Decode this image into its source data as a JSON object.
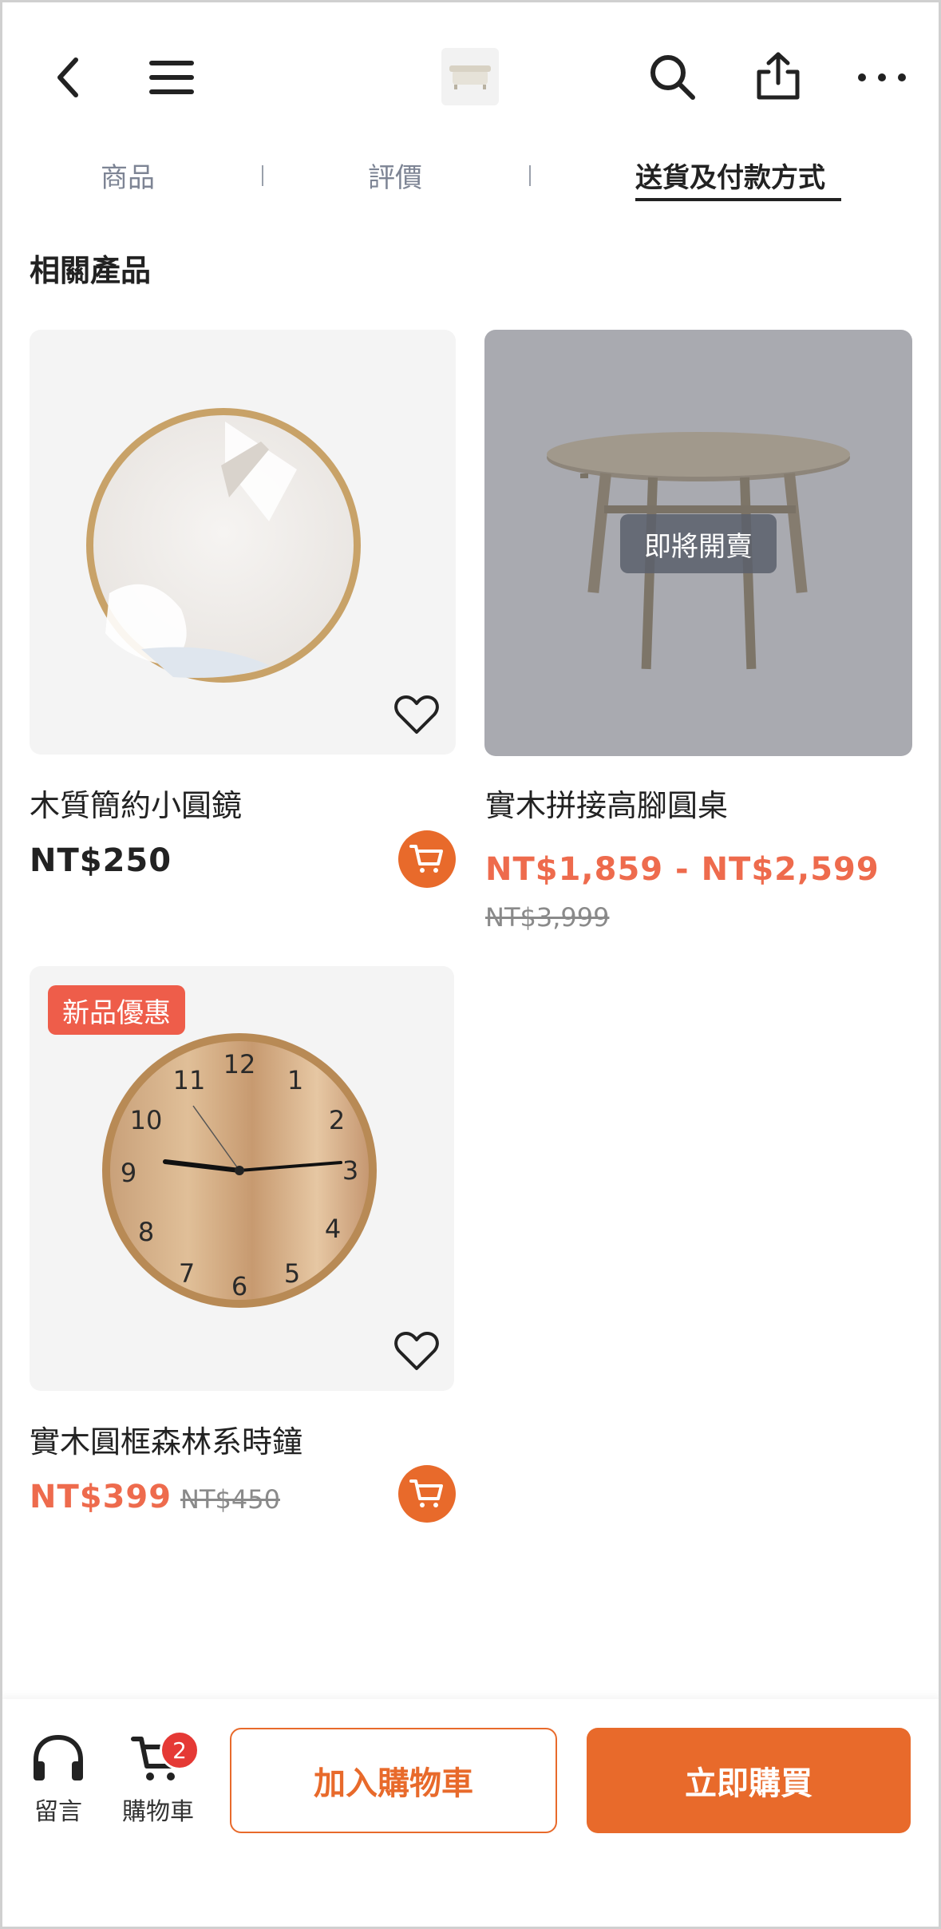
{
  "header": {
    "back_icon": "chevron-left-icon",
    "menu_icon": "hamburger-menu-icon",
    "search_icon": "search-icon",
    "share_icon": "share-icon",
    "more_icon": "more-horizontal-icon"
  },
  "tabs": [
    {
      "label": "商品",
      "active": false
    },
    {
      "label": "評價",
      "active": false
    },
    {
      "label": "送貨及付款方式",
      "active": true
    }
  ],
  "related": {
    "title": "相關產品",
    "products": [
      {
        "name": "木質簡約小圓鏡",
        "price": "NT$250",
        "old_price": "",
        "badge": ""
      },
      {
        "name": "實木拼接高腳圓桌",
        "price": "NT$1,859 - NT$2,599",
        "old_price": "NT$3,999",
        "badge": "即將開賣"
      },
      {
        "name": "實木圓框森林系時鐘",
        "price": "NT$399",
        "old_price": "NT$450",
        "badge": "新品優惠"
      }
    ]
  },
  "bottom_bar": {
    "message_label": "留言",
    "cart_label": "購物車",
    "cart_count": "2",
    "add_to_cart": "加入購物車",
    "buy_now": "立即購買"
  },
  "colors": {
    "accent": "#e86a2b",
    "price_red": "#ee6b4d",
    "badge_red": "#ee5d4a"
  }
}
